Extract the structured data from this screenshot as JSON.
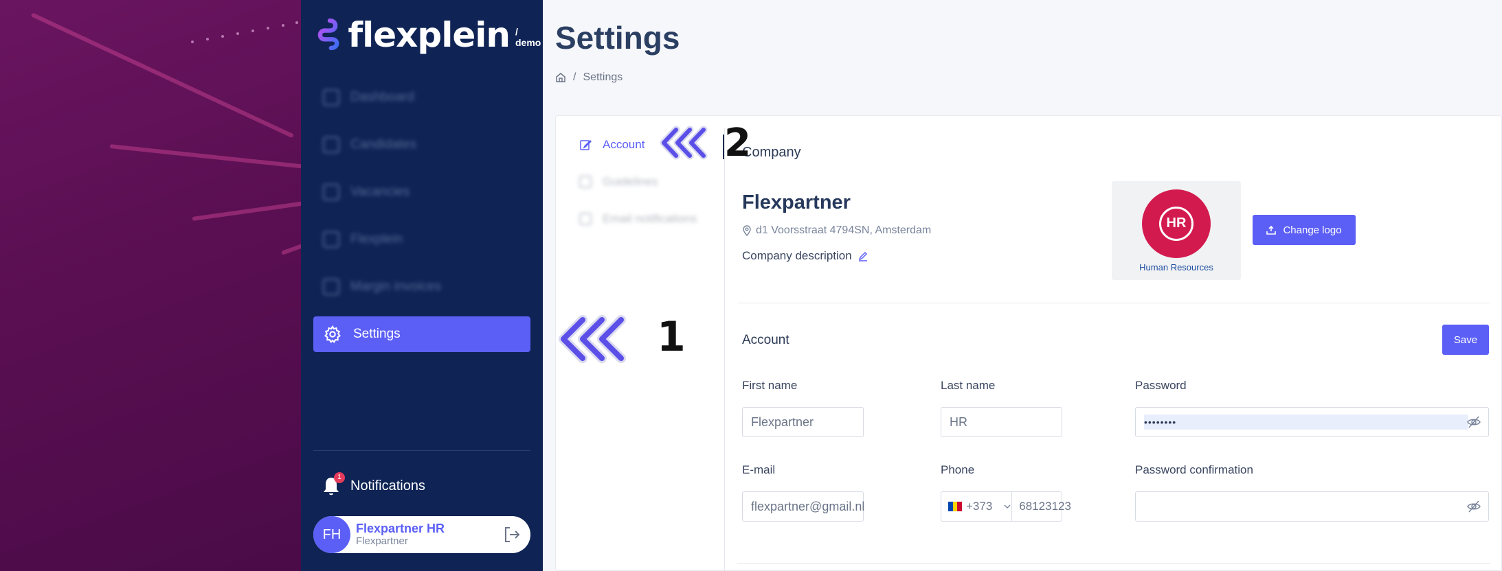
{
  "brand": {
    "name": "flexplein",
    "suffix": "/ demo"
  },
  "sidebar": {
    "items": [
      {
        "label": "Dashboard",
        "blurred": true
      },
      {
        "label": "Candidates",
        "blurred": true
      },
      {
        "label": "Vacancies",
        "blurred": true
      },
      {
        "label": "Flexplein",
        "blurred": true
      },
      {
        "label": "Margin invoices",
        "blurred": true
      },
      {
        "label": "Settings",
        "active": true
      }
    ],
    "notifications_label": "Notifications",
    "notifications_count": "1"
  },
  "user": {
    "initials": "FH",
    "name": "Flexpartner HR",
    "company": "Flexpartner"
  },
  "page": {
    "title": "Settings",
    "breadcrumb": "Settings"
  },
  "subnav": {
    "items": [
      {
        "label": "Account",
        "active": true
      },
      {
        "label": "Guidelines",
        "blurred": true
      },
      {
        "label": "Email notifications",
        "blurred": true
      }
    ]
  },
  "annotations": {
    "one": "1",
    "two": "2"
  },
  "company": {
    "section_label": "Company",
    "name": "Flexpartner",
    "address": "d1 Voorsstraat 4794SN, Amsterdam",
    "description_label": "Company description",
    "logo_caption": "Human Resources",
    "logo_letters": "HR",
    "change_logo_label": "Change logo"
  },
  "account": {
    "section_label": "Account",
    "save_label": "Save",
    "first_name_label": "First name",
    "first_name_value": "Flexpartner",
    "last_name_label": "Last name",
    "last_name_value": "HR",
    "password_label": "Password",
    "password_value": "••••••••",
    "email_label": "E-mail",
    "email_value": "flexpartner@gmail.nl",
    "phone_label": "Phone",
    "phone_code": "+373",
    "phone_number": "68123123",
    "password_confirm_label": "Password confirmation",
    "password_confirm_value": ""
  },
  "colors": {
    "accent": "#5b5ff5",
    "sidebar": "#0f2455",
    "background": "#f6f7fa"
  }
}
